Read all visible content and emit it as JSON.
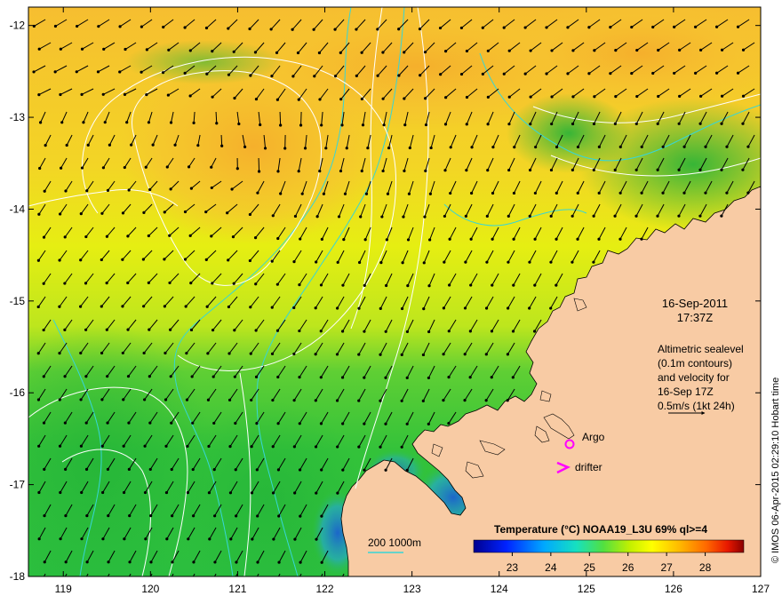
{
  "map": {
    "lon_range": [
      118.6,
      127
    ],
    "lat_range": [
      -18,
      -11.8
    ],
    "lon_ticks": [
      "119",
      "120",
      "121",
      "122",
      "123",
      "124",
      "125",
      "126",
      "127"
    ],
    "lat_ticks": [
      "-12",
      "-13",
      "-14",
      "-15",
      "-16",
      "-17",
      "-18"
    ],
    "date_line1": "16-Sep-2011",
    "date_line2": "17:37Z",
    "description_lines": [
      "Altimetric sealevel",
      "(0.1m contours)",
      "and velocity for",
      "16-Sep 17Z",
      "0.5m/s (1kt 24h)"
    ],
    "argo_label": "Argo",
    "drifter_label": "drifter",
    "bathymetry_legend": "200  1000m",
    "credit": "© IMOS 06-Apr-2015 02:29:10 Hobart time",
    "colors": {
      "land": "#f8cba4",
      "warm": "#f6bc30",
      "mid": "#e9ed10",
      "cool": "#2fc33a",
      "contour": "#ffffff",
      "bathymetry": "#37d6d6",
      "markers": "#ff00ff"
    }
  },
  "colorbar": {
    "title": "Temperature (°C) NOAA19_L3U 69% ql>=4",
    "ticks": [
      "23",
      "24",
      "25",
      "26",
      "27",
      "28"
    ],
    "range": [
      22,
      29
    ]
  }
}
